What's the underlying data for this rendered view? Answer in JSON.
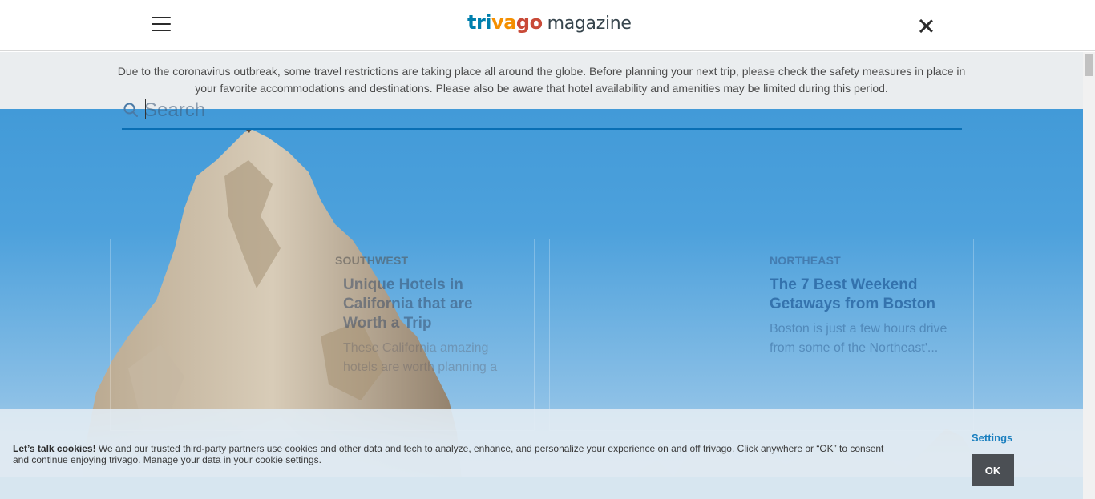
{
  "header": {
    "brand_part1": "tri",
    "brand_part2": "va",
    "brand_part3": "go",
    "brand_suffix": "magazine"
  },
  "notice": {
    "text": "Due to the coronavirus outbreak, some travel restrictions are taking place all around the globe. Before planning your next trip, please check the safety measures in place in your favorite accommodations and destinations. Please also be aware that hotel availability and amenities may be limited during this period."
  },
  "search": {
    "placeholder": "Search",
    "value": ""
  },
  "articles": [
    {
      "category": "SOUTHWEST",
      "title": "Unique Hotels in California that are Worth a Trip",
      "description": "These California amazing hotels are worth planning a"
    },
    {
      "category": "NORTHEAST",
      "title": "The 7 Best Weekend Getaways from Boston",
      "description": "Boston is just a few hours drive from some of the Northeast'..."
    }
  ],
  "cookie": {
    "title": "Let’s talk cookies!",
    "text": " We and our trusted third-party partners use cookies and other data and tech to analyze, enhance, and personalize your experience on and off trivago. Click anywhere or “OK” to consent and continue enjoying trivago. Manage your data in your cookie settings.",
    "settings_label": "Settings",
    "ok_label": "OK"
  },
  "icons": {
    "menu": "hamburger-menu-icon",
    "close": "close-icon",
    "search": "search-icon"
  },
  "colors": {
    "brand_blue": "#007fad",
    "brand_orange": "#f48f00",
    "brand_red": "#c94a38",
    "accent_link": "#1a7fbf",
    "search_underline": "#0a6fb4"
  }
}
